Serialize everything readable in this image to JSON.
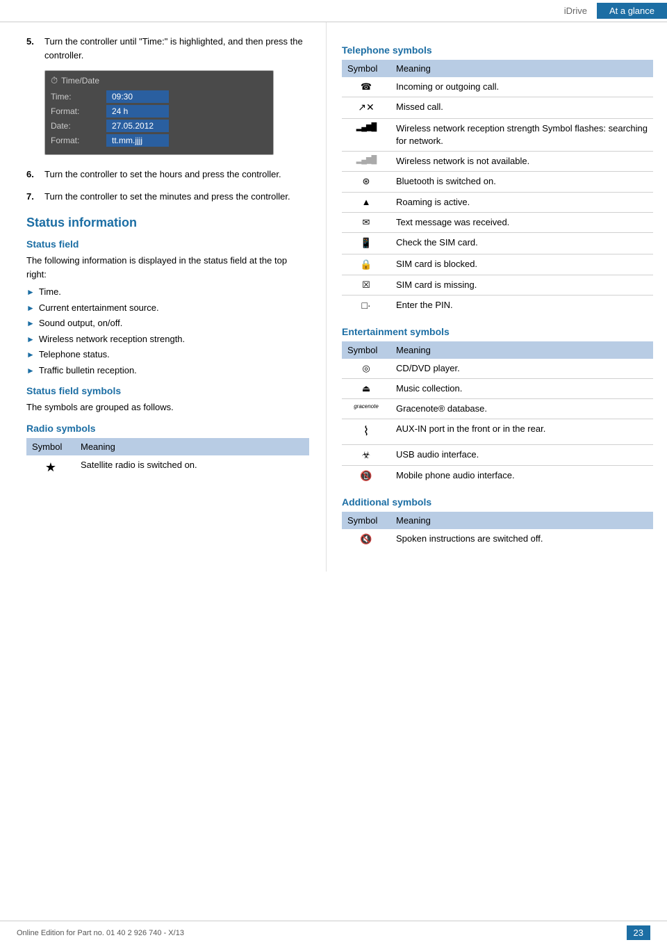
{
  "header": {
    "idrive_label": "iDrive",
    "at_glance_label": "At a glance"
  },
  "left_col": {
    "steps": [
      {
        "num": "5.",
        "text": "Turn the controller until \"Time:\" is highlighted, and then press the controller."
      },
      {
        "num": "6.",
        "text": "Turn the controller to set the hours and press the controller."
      },
      {
        "num": "7.",
        "text": "Turn the controller to set the minutes and press the controller."
      }
    ],
    "widget": {
      "title": "Time/Date",
      "rows": [
        {
          "label": "Time:",
          "value": "09:30",
          "highlighted": true
        },
        {
          "label": "Format:",
          "value": "24 h"
        },
        {
          "label": "Date:",
          "value": "27.05.2012"
        },
        {
          "label": "Format:",
          "value": "tt.mm.jjjj"
        }
      ]
    },
    "status_info_heading": "Status information",
    "status_field_heading": "Status field",
    "status_field_intro": "The following information is displayed in the status field at the top right:",
    "status_field_bullets": [
      "Time.",
      "Current entertainment source.",
      "Sound output, on/off.",
      "Wireless network reception strength.",
      "Telephone status.",
      "Traffic bulletin reception."
    ],
    "status_field_symbols_heading": "Status field symbols",
    "status_field_symbols_intro": "The symbols are grouped as follows.",
    "radio_symbols_heading": "Radio symbols",
    "radio_table": {
      "col1": "Symbol",
      "col2": "Meaning",
      "rows": [
        {
          "symbol": "★",
          "meaning": "Satellite radio is switched on."
        }
      ]
    }
  },
  "right_col": {
    "telephone_heading": "Telephone symbols",
    "telephone_table": {
      "col1": "Symbol",
      "col2": "Meaning",
      "rows": [
        {
          "symbol": "☎",
          "meaning": "Incoming or outgoing call."
        },
        {
          "symbol": "↗✕",
          "meaning": "Missed call."
        },
        {
          "symbol": "▂▄▆",
          "meaning": "Wireless network reception strength Symbol flashes: searching for network."
        },
        {
          "symbol": "▂▄▆̶",
          "meaning": "Wireless network is not available."
        },
        {
          "symbol": "⊛",
          "meaning": "Bluetooth is switched on."
        },
        {
          "symbol": "▲",
          "meaning": "Roaming is active."
        },
        {
          "symbol": "✉",
          "meaning": "Text message was received."
        },
        {
          "symbol": "🖲",
          "meaning": "Check the SIM card."
        },
        {
          "symbol": "🔒",
          "meaning": "SIM card is blocked."
        },
        {
          "symbol": "☒",
          "meaning": "SIM card is missing."
        },
        {
          "symbol": "□·",
          "meaning": "Enter the PIN."
        }
      ]
    },
    "entertainment_heading": "Entertainment symbols",
    "entertainment_table": {
      "col1": "Symbol",
      "col2": "Meaning",
      "rows": [
        {
          "symbol": "◎",
          "meaning": "CD/DVD player."
        },
        {
          "symbol": "⏏",
          "meaning": "Music collection."
        },
        {
          "symbol": "gracenote",
          "meaning": "Gracenote® database."
        },
        {
          "symbol": "⌇",
          "meaning": "AUX-IN port in the front or in the rear."
        },
        {
          "symbol": "⏣",
          "meaning": "USB audio interface."
        },
        {
          "symbol": "📵",
          "meaning": "Mobile phone audio interface."
        }
      ]
    },
    "additional_heading": "Additional symbols",
    "additional_table": {
      "col1": "Symbol",
      "col2": "Meaning",
      "rows": [
        {
          "symbol": "🔇",
          "meaning": "Spoken instructions are switched off."
        }
      ]
    }
  },
  "footer": {
    "text": "Online Edition for Part no. 01 40 2 926 740 - X/13",
    "page": "23"
  }
}
